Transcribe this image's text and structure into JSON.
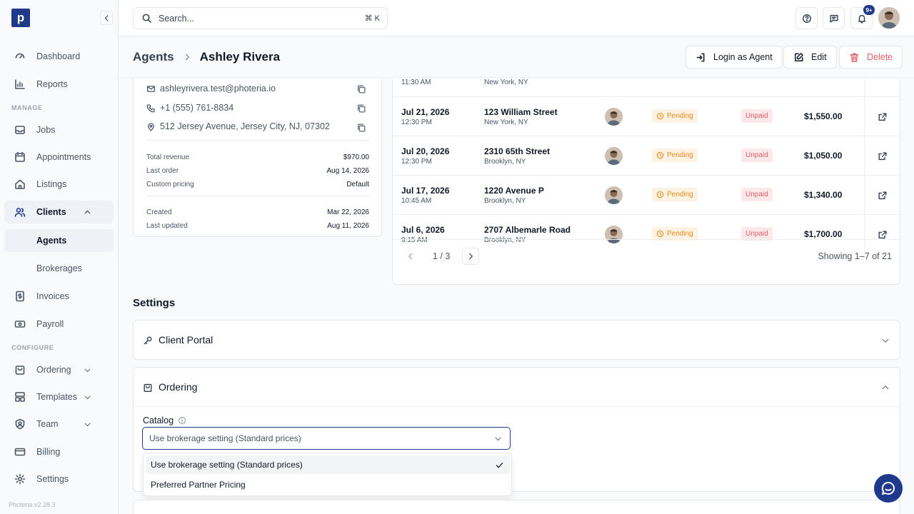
{
  "app": {
    "logo_letter": "p",
    "version": "Photeria v2.28.3"
  },
  "sidebar": {
    "top_items": [
      {
        "label": "Dashboard",
        "icon": "dashboard-icon"
      },
      {
        "label": "Reports",
        "icon": "bar-chart-icon"
      }
    ],
    "section_manage": "MANAGE",
    "manage_items": [
      {
        "label": "Jobs",
        "icon": "inbox-icon"
      },
      {
        "label": "Appointments",
        "icon": "calendar-icon"
      },
      {
        "label": "Listings",
        "icon": "home-icon"
      },
      {
        "label": "Clients",
        "icon": "users-icon",
        "expanded": true
      }
    ],
    "clients_sub": [
      "Agents",
      "Brokerages"
    ],
    "more_manage": [
      {
        "label": "Invoices",
        "icon": "dollar-file-icon"
      },
      {
        "label": "Payroll",
        "icon": "cash-icon"
      }
    ],
    "section_configure": "CONFIGURE",
    "configure_items": [
      {
        "label": "Ordering",
        "icon": "bag-icon"
      },
      {
        "label": "Templates",
        "icon": "template-icon"
      },
      {
        "label": "Team",
        "icon": "team-icon"
      },
      {
        "label": "Billing",
        "icon": "credit-card-icon"
      },
      {
        "label": "Settings",
        "icon": "gear-icon"
      }
    ]
  },
  "topbar": {
    "search_placeholder": "Search...",
    "shortcut": "⌘ K",
    "notification_badge": "9+"
  },
  "header": {
    "breadcrumb_parent": "Agents",
    "breadcrumb_current": "Ashley Rivera",
    "login_as_agent": "Login as Agent",
    "edit": "Edit",
    "delete": "Delete"
  },
  "contact": {
    "email": "ashleyrivera.test@photeria.io",
    "phone": "+1 (555) 761-8834",
    "address": "512 Jersey Avenue, Jersey City, NJ, 07302",
    "stats": [
      {
        "label": "Total revenue",
        "value": "$970.00"
      },
      {
        "label": "Last order",
        "value": "Aug 14, 2026"
      },
      {
        "label": "Custom pricing",
        "value": "Default"
      }
    ],
    "dates": [
      {
        "label": "Created",
        "value": "Mar 22, 2026"
      },
      {
        "label": "Last updated",
        "value": "Aug 11, 2026"
      }
    ]
  },
  "orders": {
    "partial_row": {
      "time": "11:30 AM",
      "city": "New York, NY"
    },
    "rows": [
      {
        "date": "Jul 21, 2026",
        "time": "12:30 PM",
        "address": "123 William Street",
        "city": "New York, NY",
        "status": "Pending",
        "payment": "Unpaid",
        "amount": "$1,550.00"
      },
      {
        "date": "Jul 20, 2026",
        "time": "12:30 PM",
        "address": "2310 65th Street",
        "city": "Brooklyn, NY",
        "status": "Pending",
        "payment": "Unpaid",
        "amount": "$1,050.00"
      },
      {
        "date": "Jul 17, 2026",
        "time": "10:45 AM",
        "address": "1220 Avenue P",
        "city": "Brooklyn, NY",
        "status": "Pending",
        "payment": "Unpaid",
        "amount": "$1,340.00"
      },
      {
        "date": "Jul 6, 2026",
        "time": "9:15 AM",
        "address": "2707 Albemarle Road",
        "city": "Brooklyn, NY",
        "status": "Pending",
        "payment": "Unpaid",
        "amount": "$1,700.00"
      }
    ],
    "page": "1 / 3",
    "showing": "Showing 1–7 of 21"
  },
  "settings": {
    "title": "Settings",
    "client_portal": "Client Portal",
    "ordering": "Ordering",
    "catalog_label": "Catalog",
    "catalog_value": "Use brokerage setting (Standard prices)",
    "options": [
      "Use brokerage setting (Standard prices)",
      "Preferred Partner Pricing"
    ]
  },
  "colors": {
    "brand": "#1f3a8a",
    "pending": "#e68a1a",
    "unpaid": "#e0606b"
  }
}
